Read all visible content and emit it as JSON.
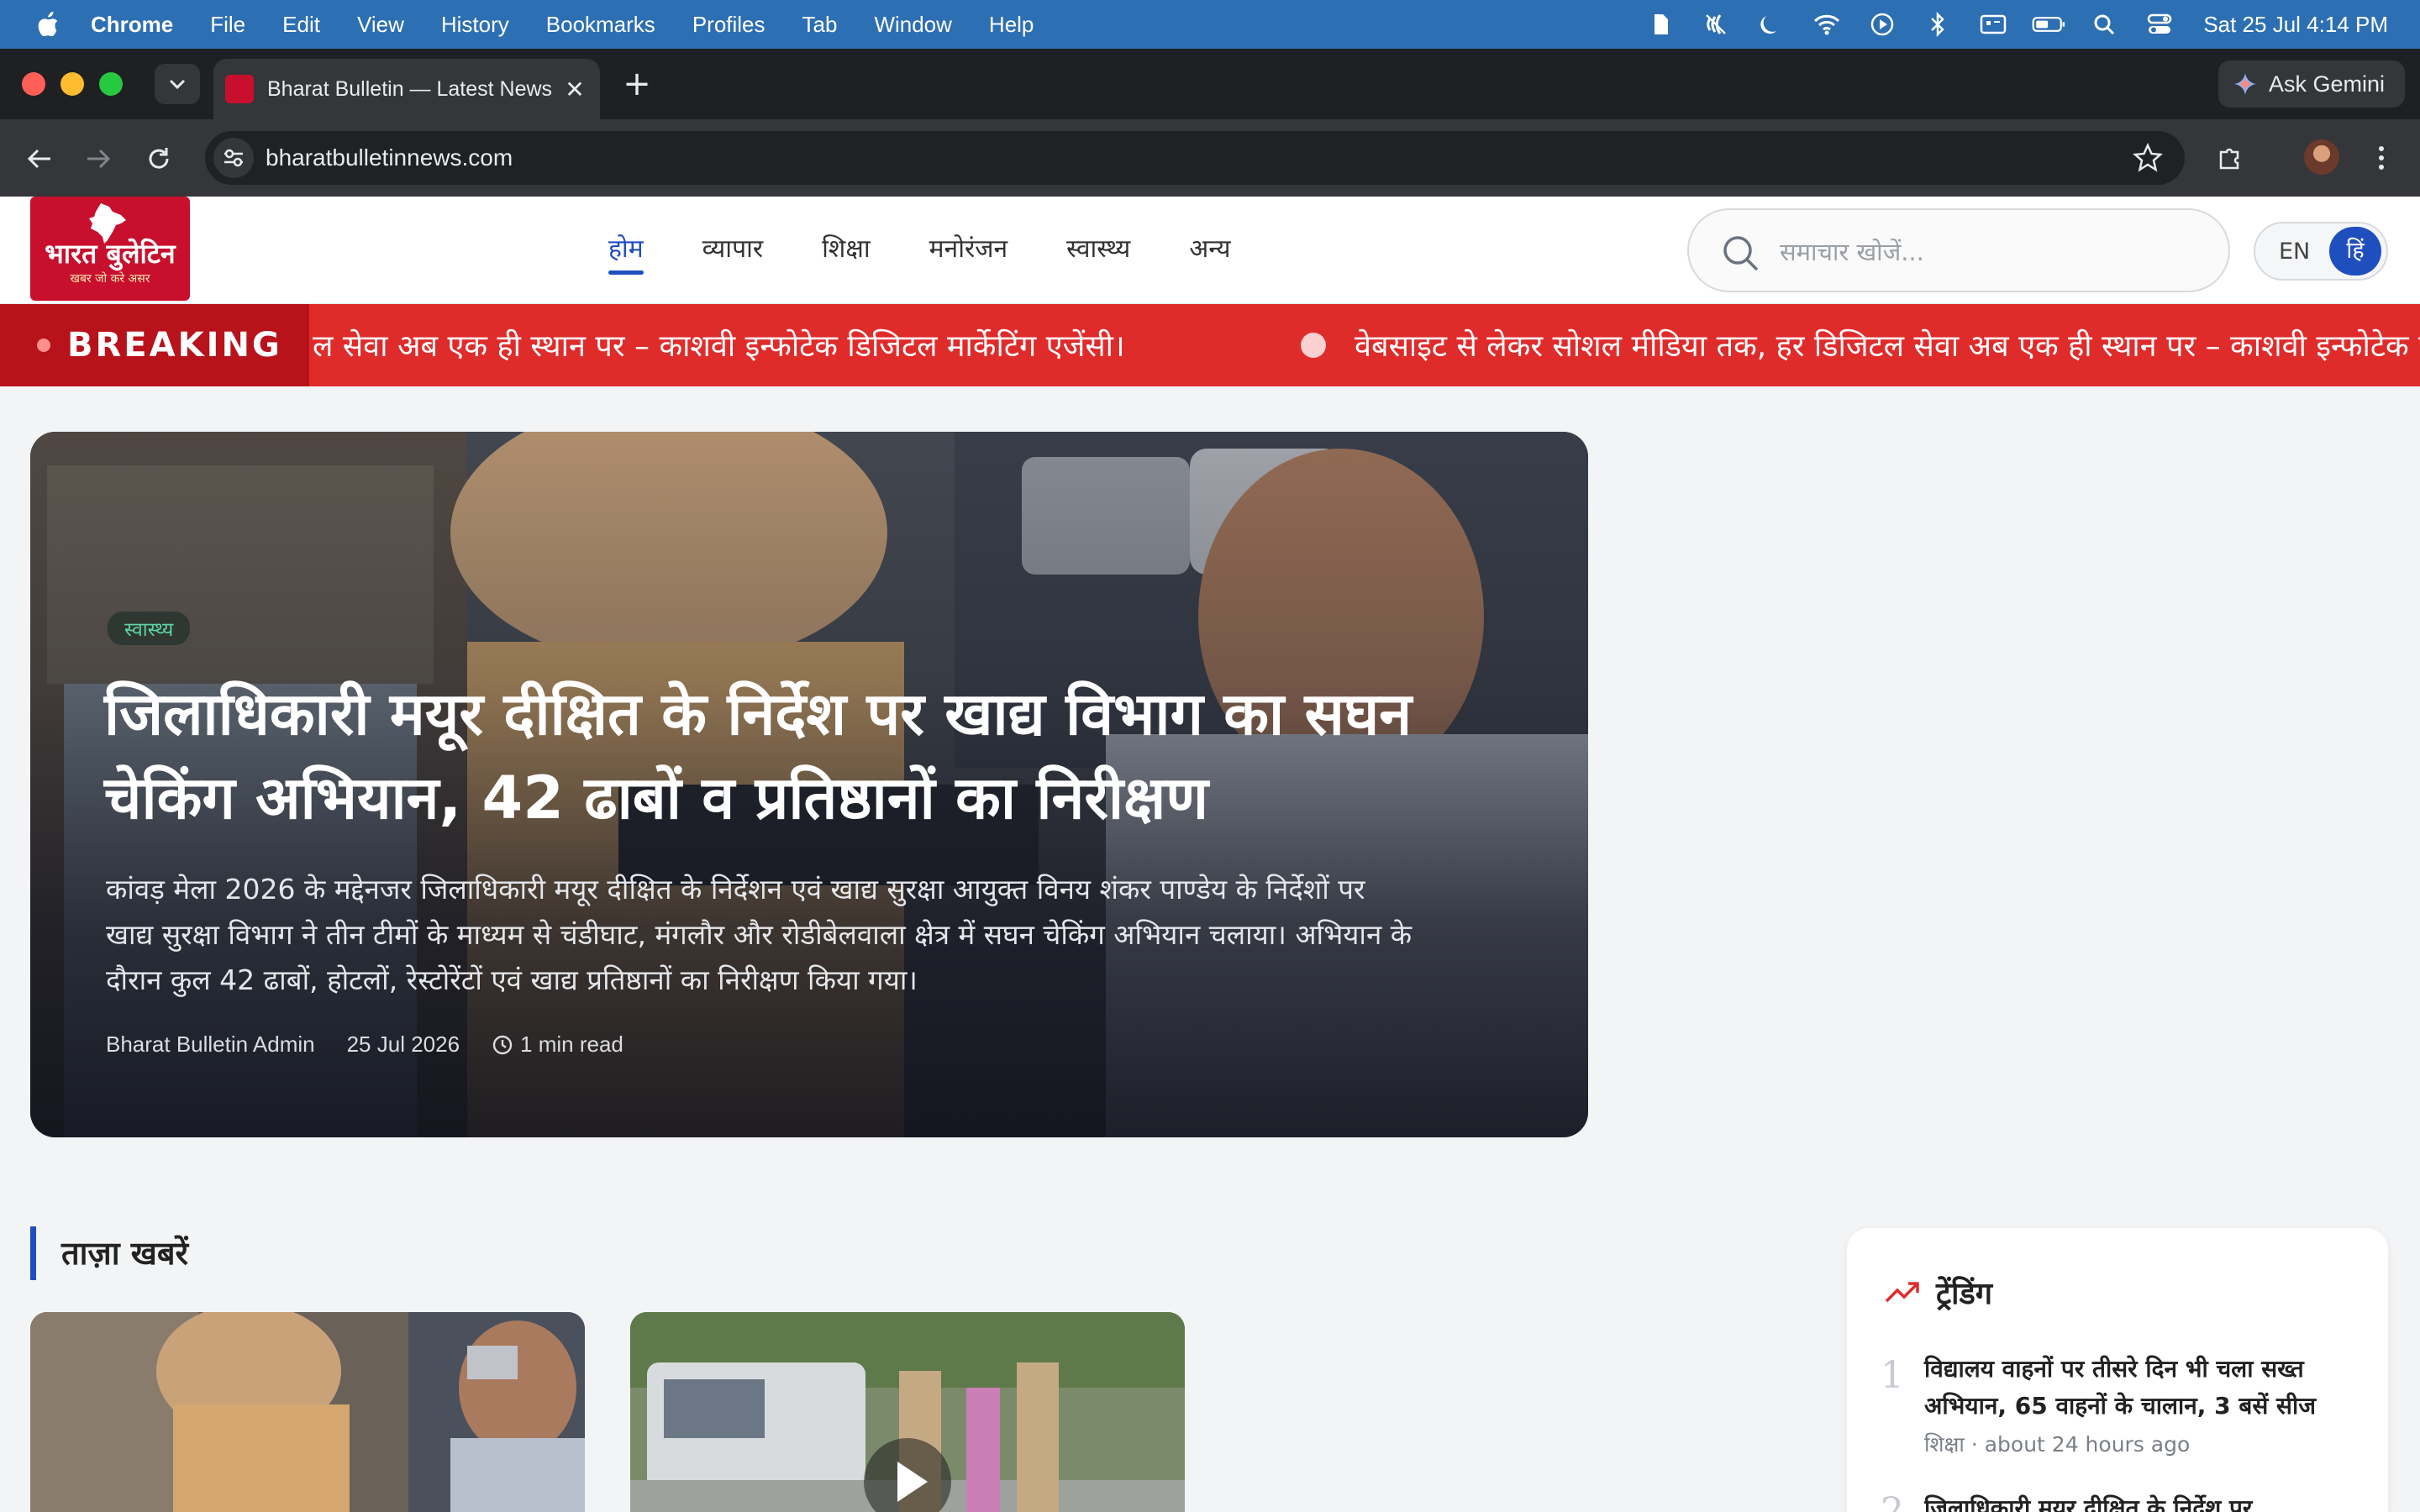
{
  "menubar": {
    "app": "Chrome",
    "items": [
      "File",
      "Edit",
      "View",
      "History",
      "Bookmarks",
      "Profiles",
      "Tab",
      "Window",
      "Help"
    ],
    "clock": "Sat 25 Jul  4:14 PM"
  },
  "browser": {
    "tab_title": "Bharat Bulletin — Latest News",
    "new_tab": "+",
    "close_tab": "✕",
    "gemini_label": "Ask Gemini",
    "url": "bharatbulletinnews.com"
  },
  "site": {
    "logo_title": "भारत बुलेटिन",
    "logo_tagline": "खबर जो करे असर",
    "nav": [
      "होम",
      "व्यापार",
      "शिक्षा",
      "मनोरंजन",
      "स्वास्थ्य",
      "अन्य"
    ],
    "search_placeholder": "समाचार खोजें...",
    "lang_en": "EN",
    "lang_hi": "हिं"
  },
  "breaking": {
    "label": "BREAKING",
    "ticker_1": "ल सेवा अब एक ही स्थान पर – काशवी इन्फोटेक डिजिटल मार्केटिंग एजेंसी।",
    "ticker_2": "वेबसाइट से लेकर सोशल मीडिया तक, हर डिजिटल सेवा अब एक ही स्थान पर – काशवी इन्फोटेक डिजिटल मार्केटिंग एजेंसी।"
  },
  "hero": {
    "category": "स्वास्थ्य",
    "headline": "जिलाधिकारी मयूर दीक्षित के निर्देश पर खाद्य विभाग का सघन चेकिंग अभियान, 42 ढाबों व प्रतिष्ठानों का निरीक्षण",
    "summary": "कांवड़ मेला 2026 के मद्देनजर जिलाधिकारी मयूर दीक्षित के निर्देशन एवं खाद्य सुरक्षा आयुक्त विनय शंकर पाण्डेय के निर्देशों पर खाद्य सुरक्षा विभाग ने तीन टीमों के माध्यम से चंडीघाट, मंगलौर और रोडीबेलवाला क्षेत्र में सघन चेकिंग अभियान चलाया। अभियान के दौरान कुल 42 ढाबों, होटलों, रेस्टोरेंटों एवं खाद्य प्रतिष्ठानों का निरीक्षण किया गया।",
    "author": "Bharat Bulletin Admin",
    "date": "25 Jul 2026",
    "read_time": "1 min read"
  },
  "latest": {
    "title": "ताज़ा खबरें"
  },
  "trending": {
    "title": "ट्रेंडिंग",
    "items": [
      {
        "rank": "1",
        "title": "विद्यालय वाहनों पर तीसरे दिन भी चला सख्त अभियान, 65 वाहनों के चालान, 3 बसें सीज",
        "meta": "शिक्षा · about 24 hours ago"
      },
      {
        "rank": "2",
        "title": "जिलाधिकारी मयूर दीक्षित के निर्देश पर",
        "meta": ""
      }
    ]
  },
  "colors": {
    "brand_red": "#c8102e",
    "breaking_red": "#e02b2b",
    "accent_blue": "#1f4fbf",
    "category_green": "#5fd3a3"
  }
}
